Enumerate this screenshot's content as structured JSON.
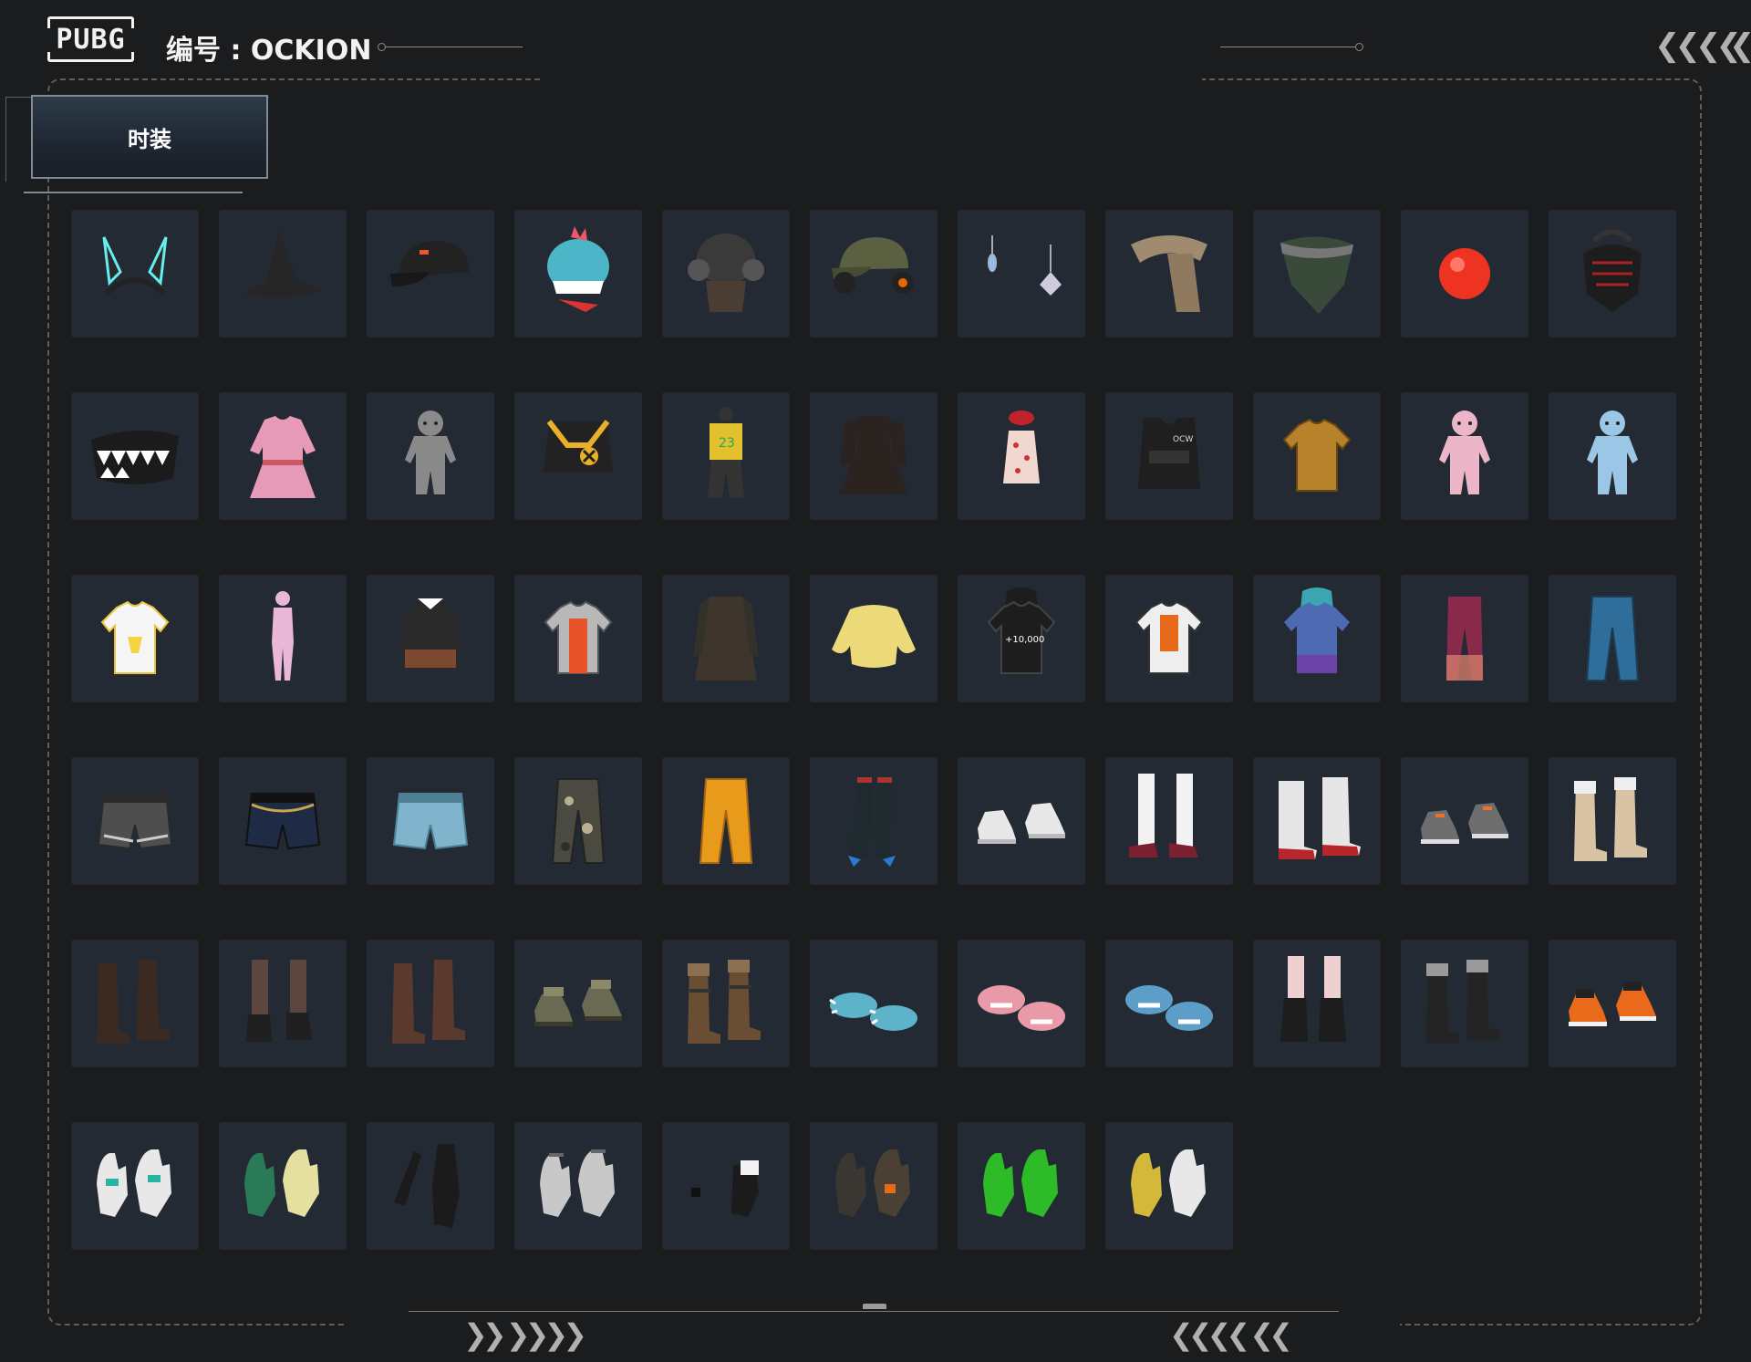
{
  "header": {
    "logo_text": "PUBG",
    "serial_label": "编号 : OCKION"
  },
  "tabs": [
    {
      "label": "时装",
      "active": true
    }
  ],
  "colors": {
    "background": "#1b1c1e",
    "tile": "#232a34",
    "frame": "#5e5e5e"
  },
  "items": [
    {
      "name": "bunny-ears-headband-icon",
      "kind": "ears"
    },
    {
      "name": "witch-hat-icon",
      "kind": "witchhat"
    },
    {
      "name": "black-cap-icon",
      "kind": "cap"
    },
    {
      "name": "dinosaur-mask-icon",
      "kind": "dino"
    },
    {
      "name": "aviator-helmet-icon",
      "kind": "aviator"
    },
    {
      "name": "army-cap-headset-icon",
      "kind": "armycap"
    },
    {
      "name": "earrings-icon",
      "kind": "earrings"
    },
    {
      "name": "camo-scarf-icon",
      "kind": "scarf"
    },
    {
      "name": "camo-bandana-icon",
      "kind": "bandana"
    },
    {
      "name": "clown-nose-icon",
      "kind": "nose"
    },
    {
      "name": "tactical-face-mask-icon",
      "kind": "facemask"
    },
    {
      "name": "shark-teeth-mask-icon",
      "kind": "teethmask"
    },
    {
      "name": "pink-school-uniform-icon",
      "kind": "pinkdress"
    },
    {
      "name": "grey-onesie-icon",
      "kind": "onesie"
    },
    {
      "name": "x-crop-top-icon",
      "kind": "croptop"
    },
    {
      "name": "basketball-jersey-icon",
      "kind": "jersey"
    },
    {
      "name": "black-dress-icon",
      "kind": "blackdress"
    },
    {
      "name": "polka-dot-swimsuit-icon",
      "kind": "swimsuit"
    },
    {
      "name": "tactical-vest-icon",
      "kind": "vest"
    },
    {
      "name": "mustard-sweater-icon",
      "kind": "sweater"
    },
    {
      "name": "pink-shark-pajamas-icon",
      "kind": "pinkpj"
    },
    {
      "name": "blue-shark-pajamas-icon",
      "kind": "bluepj"
    },
    {
      "name": "pikachu-tshirt-icon",
      "kind": "tshirt"
    },
    {
      "name": "pink-bodysuit-icon",
      "kind": "bodysuit"
    },
    {
      "name": "black-halter-top-icon",
      "kind": "halter"
    },
    {
      "name": "racing-jacket-icon",
      "kind": "racing"
    },
    {
      "name": "long-trench-coat-icon",
      "kind": "trench"
    },
    {
      "name": "yellow-fluffy-sweater-icon",
      "kind": "fluffy"
    },
    {
      "name": "black-hoodie-icon",
      "kind": "hoodie"
    },
    {
      "name": "space-jacket-icon",
      "kind": "spacejacket"
    },
    {
      "name": "gradient-hoodie-icon",
      "kind": "gradhoodie"
    },
    {
      "name": "ombre-leggings-icon",
      "kind": "leggings"
    },
    {
      "name": "blue-jeans-icon",
      "kind": "jeans"
    },
    {
      "name": "striped-shorts-icon",
      "kind": "stripeshorts"
    },
    {
      "name": "denim-shorts-chain-icon",
      "kind": "chainshorts"
    },
    {
      "name": "light-denim-shorts-icon",
      "kind": "lightshorts"
    },
    {
      "name": "camo-pants-icon",
      "kind": "camopants"
    },
    {
      "name": "orange-pants-icon",
      "kind": "orangepants"
    },
    {
      "name": "thigh-high-stockings-icon",
      "kind": "stockings"
    },
    {
      "name": "white-sneakers-icon",
      "kind": "sneakers"
    },
    {
      "name": "white-socks-mary-janes-icon",
      "kind": "maryjanes"
    },
    {
      "name": "fur-boots-icon",
      "kind": "furboots"
    },
    {
      "name": "grey-sneakers-orange-laces-icon",
      "kind": "greysneakers"
    },
    {
      "name": "beige-winter-boots-icon",
      "kind": "beigeboots"
    },
    {
      "name": "brown-lace-up-boots-icon",
      "kind": "brownboots"
    },
    {
      "name": "stockings-ankle-boots-icon",
      "kind": "stockboots"
    },
    {
      "name": "brown-knee-boots-icon",
      "kind": "kneeboots"
    },
    {
      "name": "green-hiking-boots-icon",
      "kind": "hikingboots"
    },
    {
      "name": "strapped-combat-boots-icon",
      "kind": "combatboots"
    },
    {
      "name": "blue-claw-slippers-icon",
      "kind": "clawslippers"
    },
    {
      "name": "pink-shark-slippers-icon",
      "kind": "pinkslippers"
    },
    {
      "name": "blue-shark-slippers-icon",
      "kind": "blueslippers"
    },
    {
      "name": "socks-black-boots-icon",
      "kind": "socksboots"
    },
    {
      "name": "black-fur-boots-icon",
      "kind": "blackfurboots"
    },
    {
      "name": "orange-high-tops-icon",
      "kind": "hightops"
    },
    {
      "name": "motocross-gloves-icon",
      "kind": "motogloves"
    },
    {
      "name": "work-gloves-icon",
      "kind": "workgloves"
    },
    {
      "name": "black-long-gloves-icon",
      "kind": "longgloves"
    },
    {
      "name": "white-bracelet-hands-icon",
      "kind": "bracelets"
    },
    {
      "name": "tuxedo-cuff-icon",
      "kind": "cuffs"
    },
    {
      "name": "tactical-gloves-icon",
      "kind": "tacgloves"
    },
    {
      "name": "green-gloves-icon",
      "kind": "greengloves"
    },
    {
      "name": "white-yellow-gloves-icon",
      "kind": "whitegloves"
    }
  ]
}
